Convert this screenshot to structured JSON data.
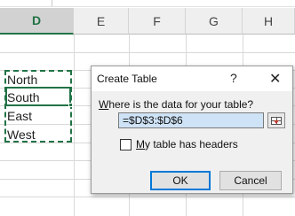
{
  "spreadsheet": {
    "column_headers": [
      "D",
      "E",
      "F",
      "G",
      "H"
    ],
    "selected_column": "D",
    "cells": [
      "North",
      "South",
      "East",
      "West"
    ],
    "accent_color": "#217346"
  },
  "dialog": {
    "title": "Create Table",
    "help_glyph": "?",
    "close_glyph": "✕",
    "prompt_label": "Where is the data for your table?",
    "prompt_label_mnemonic": "W",
    "prompt_label_rest": "here is the data for your table?",
    "range_value": "=$D$3:$D$6",
    "checkbox_label_mnemonic": "M",
    "checkbox_label_rest": "y table has headers",
    "headers_checked": false,
    "ok_label": "OK",
    "cancel_label": "Cancel",
    "collapse_icon": "collapse-dialog-icon"
  }
}
